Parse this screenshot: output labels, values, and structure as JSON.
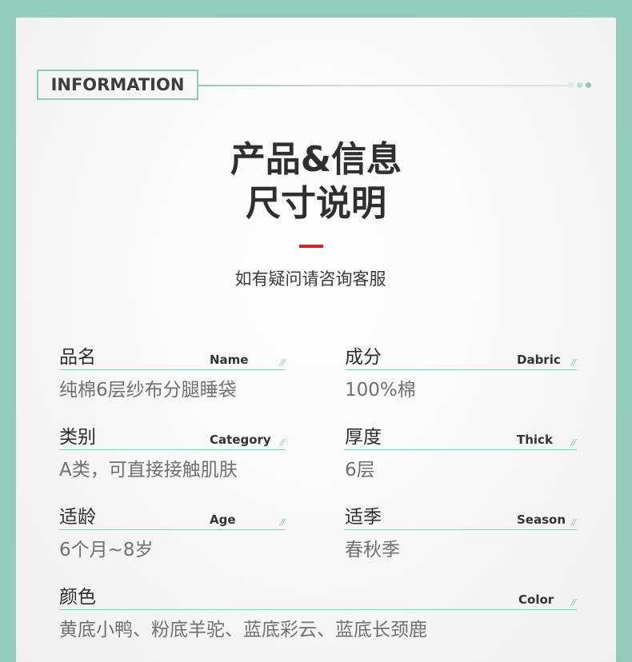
{
  "header": {
    "badge": "INFORMATION",
    "title_line1": "产品&信息",
    "title_line2": "尺寸说明",
    "subtitle": "如有疑问请咨询客服"
  },
  "colors": {
    "frame": "#93cbbd",
    "accent": "#8fc9ba",
    "red_bar": "#d6242a"
  },
  "fields": {
    "name": {
      "cn": "品名",
      "en": "Name",
      "value": "纯棉6层纱布分腿睡袋",
      "slash": "//"
    },
    "fabric": {
      "cn": "成分",
      "en": "Dabric",
      "value": "100%棉",
      "slash": "//"
    },
    "category": {
      "cn": "类别",
      "en": "Category",
      "value": "A类，可直接接触肌肤",
      "slash": "//"
    },
    "thick": {
      "cn": "厚度",
      "en": "Thick",
      "value": "6层",
      "slash": "//"
    },
    "age": {
      "cn": "适龄",
      "en": "Age",
      "value": "6个月~8岁",
      "slash": "//"
    },
    "season": {
      "cn": "适季",
      "en": "Season",
      "value": "春秋季",
      "slash": "//"
    },
    "color": {
      "cn": "颜色",
      "en": "Color",
      "value": "黄底小鸭、粉底羊驼、蓝底彩云、蓝底长颈鹿",
      "slash": "//"
    }
  }
}
